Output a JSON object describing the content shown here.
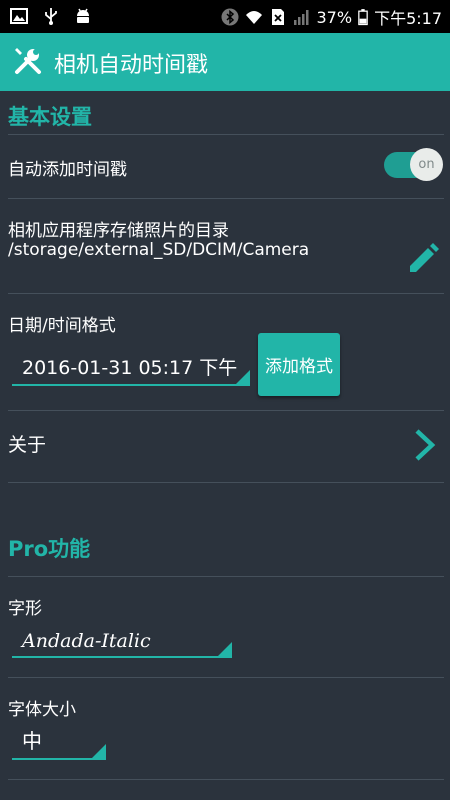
{
  "status_bar": {
    "left_icons": [
      "gallery-icon",
      "usb-icon",
      "android-debug-icon"
    ],
    "right_icons": [
      "bluetooth-icon",
      "wifi-icon",
      "no-sim-icon",
      "signal-icon"
    ],
    "battery": "37%",
    "time": "下午5:17"
  },
  "app_bar": {
    "icon": "wrench-screwdriver-icon",
    "title": "相机自动时间戳"
  },
  "basic": {
    "header": "基本设置",
    "auto_timestamp": {
      "label": "自动添加时间戳",
      "toggle": "on",
      "enabled": true
    },
    "directory": {
      "label": "相机应用程序存储照片的目录",
      "path": "/storage/external_SD/DCIM/Camera",
      "icon": "edit-icon"
    },
    "datetime": {
      "label": "日期/时间格式",
      "value": "2016-01-31 05:17 下午",
      "button": "添加格式"
    },
    "about": {
      "label": "关于",
      "icon": "chevron-right-icon"
    }
  },
  "pro": {
    "header": "Pro功能",
    "font": {
      "label": "字形",
      "value": "Andada-Italic"
    },
    "font_size": {
      "label": "字体大小",
      "value": "中"
    }
  },
  "colors": {
    "accent": "#22b5a8",
    "background": "#2b333d",
    "status_bar": "#000000"
  }
}
